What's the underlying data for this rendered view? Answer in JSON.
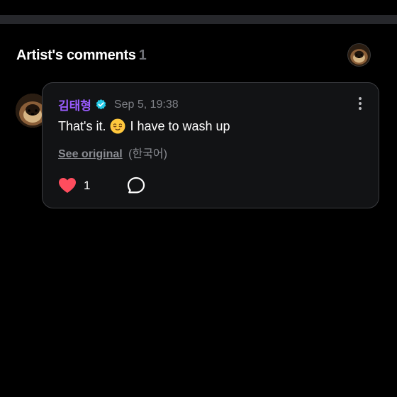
{
  "header": {
    "title": "Artist's comments",
    "count": "1"
  },
  "comment": {
    "author": "김태형",
    "verified": true,
    "timestamp": "Sep 5, 19:38",
    "text_before_emoji": "That's it.",
    "emoji": "relieved-face",
    "text_after_emoji": "I have to wash up",
    "see_original_label": "See original",
    "original_language": "(한국어)",
    "like_count": "1"
  },
  "colors": {
    "background": "#000000",
    "card_background": "#121315",
    "card_border": "#3b3c40",
    "author_name": "#9a5cff",
    "verified_badge": "#22c9e6",
    "like_heart": "#ff4d5e",
    "muted_text": "#7e8086"
  },
  "icons": {
    "verified": "verified-badge-icon",
    "more": "more-vertical-icon",
    "like": "heart-icon",
    "reply": "comment-bubble-icon"
  }
}
